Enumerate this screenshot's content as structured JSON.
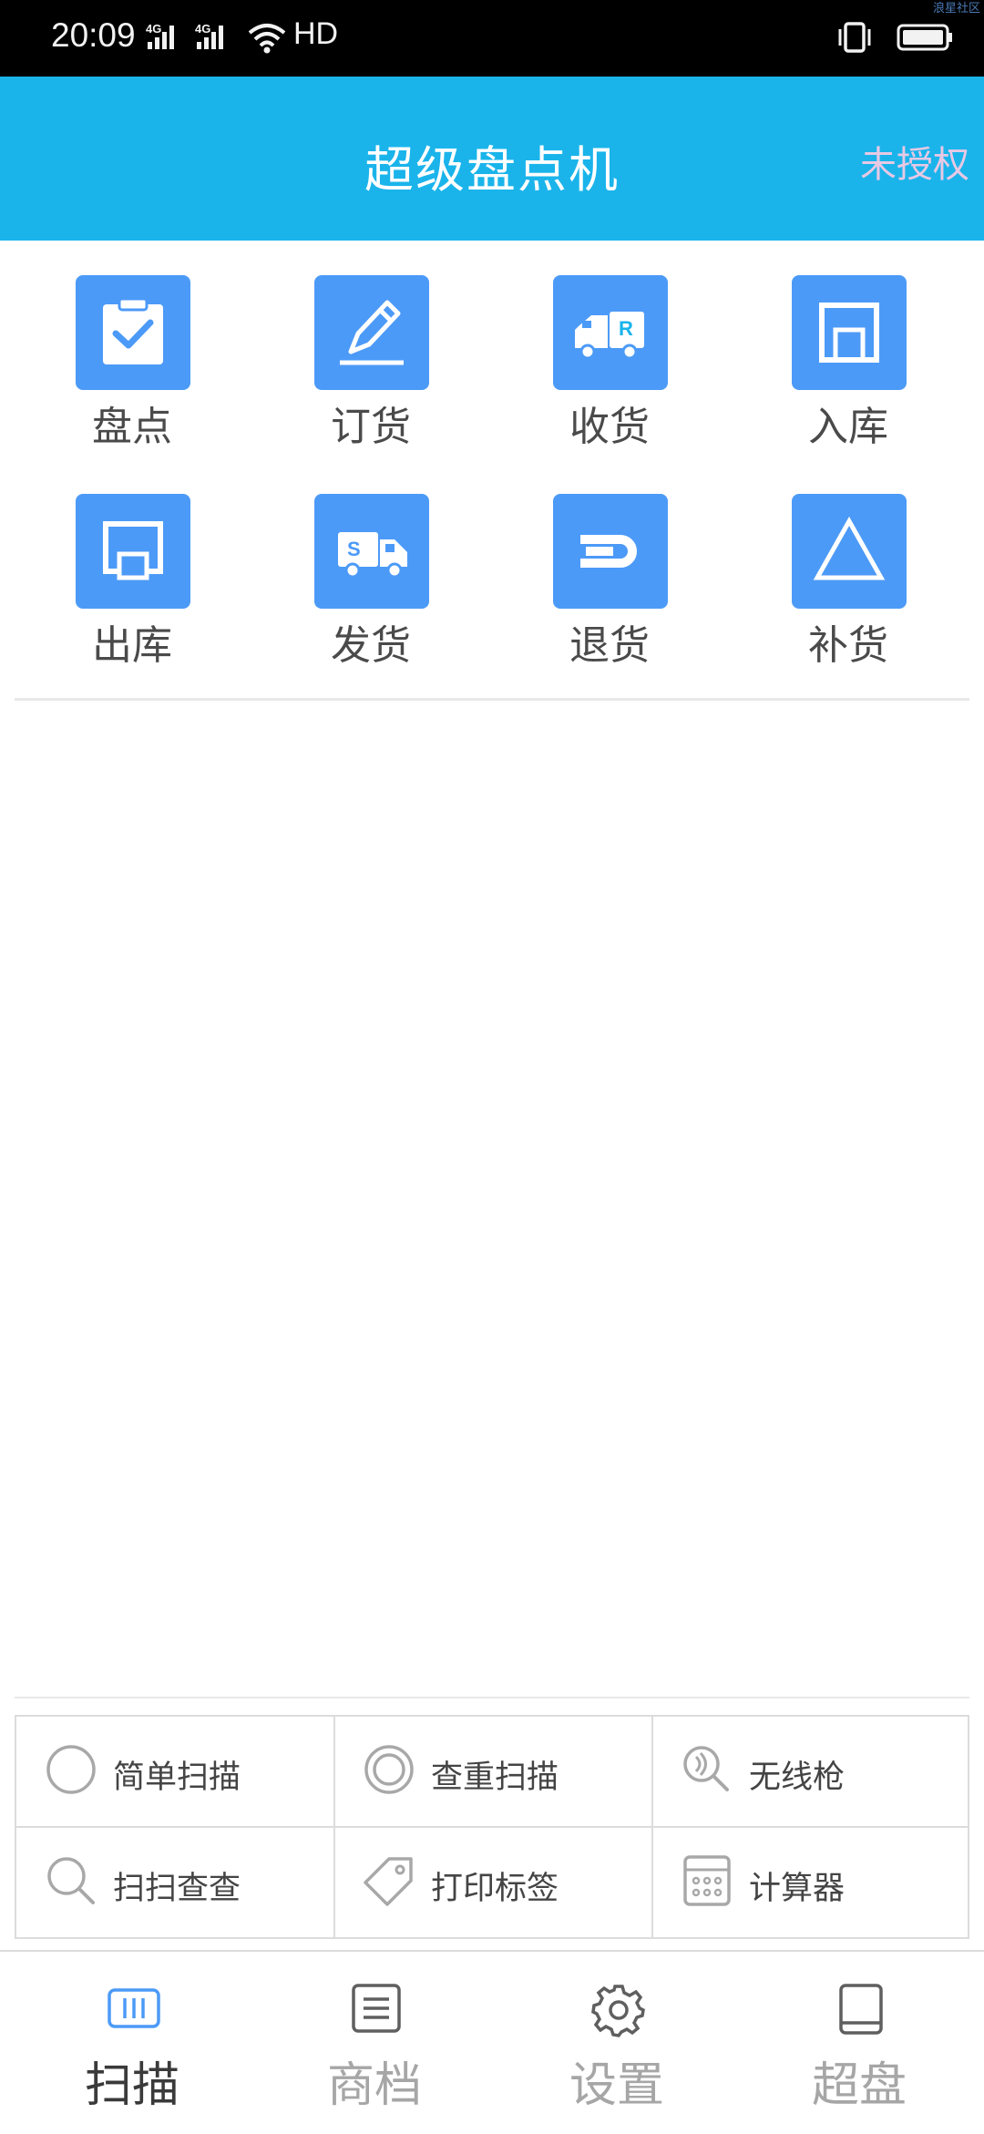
{
  "status_bar": {
    "time": "20:09",
    "network1": "4G",
    "network2": "4G",
    "hd": "HD",
    "watermark": "浪星社区"
  },
  "app": {
    "title": "超级盘点机",
    "auth_status": "未授权"
  },
  "functions": [
    {
      "label": "盘点",
      "icon": "clipboard-check-icon"
    },
    {
      "label": "订货",
      "icon": "pen-icon"
    },
    {
      "label": "收货",
      "icon": "truck-r-icon"
    },
    {
      "label": "入库",
      "icon": "inbox-icon"
    },
    {
      "label": "出库",
      "icon": "outbox-icon"
    },
    {
      "label": "发货",
      "icon": "truck-s-icon"
    },
    {
      "label": "退货",
      "icon": "return-icon"
    },
    {
      "label": "补货",
      "icon": "triangle-icon"
    }
  ],
  "tools": [
    {
      "label": "简单扫描",
      "icon": "circle-icon"
    },
    {
      "label": "查重扫描",
      "icon": "double-circle-icon"
    },
    {
      "label": "无线枪",
      "icon": "wireless-search-icon"
    },
    {
      "label": "扫扫查查",
      "icon": "search-icon"
    },
    {
      "label": "打印标签",
      "icon": "tag-icon"
    },
    {
      "label": "计算器",
      "icon": "calculator-icon"
    }
  ],
  "bottom_nav": [
    {
      "label": "扫描",
      "icon": "barcode-icon",
      "active": true
    },
    {
      "label": "商档",
      "icon": "list-icon",
      "active": false
    },
    {
      "label": "设置",
      "icon": "gear-icon",
      "active": false
    },
    {
      "label": "超盘",
      "icon": "book-icon",
      "active": false
    }
  ],
  "colors": {
    "header": "#1ab4eb",
    "tile": "#4c9af7",
    "active_nav_icon": "#4c9af7"
  }
}
